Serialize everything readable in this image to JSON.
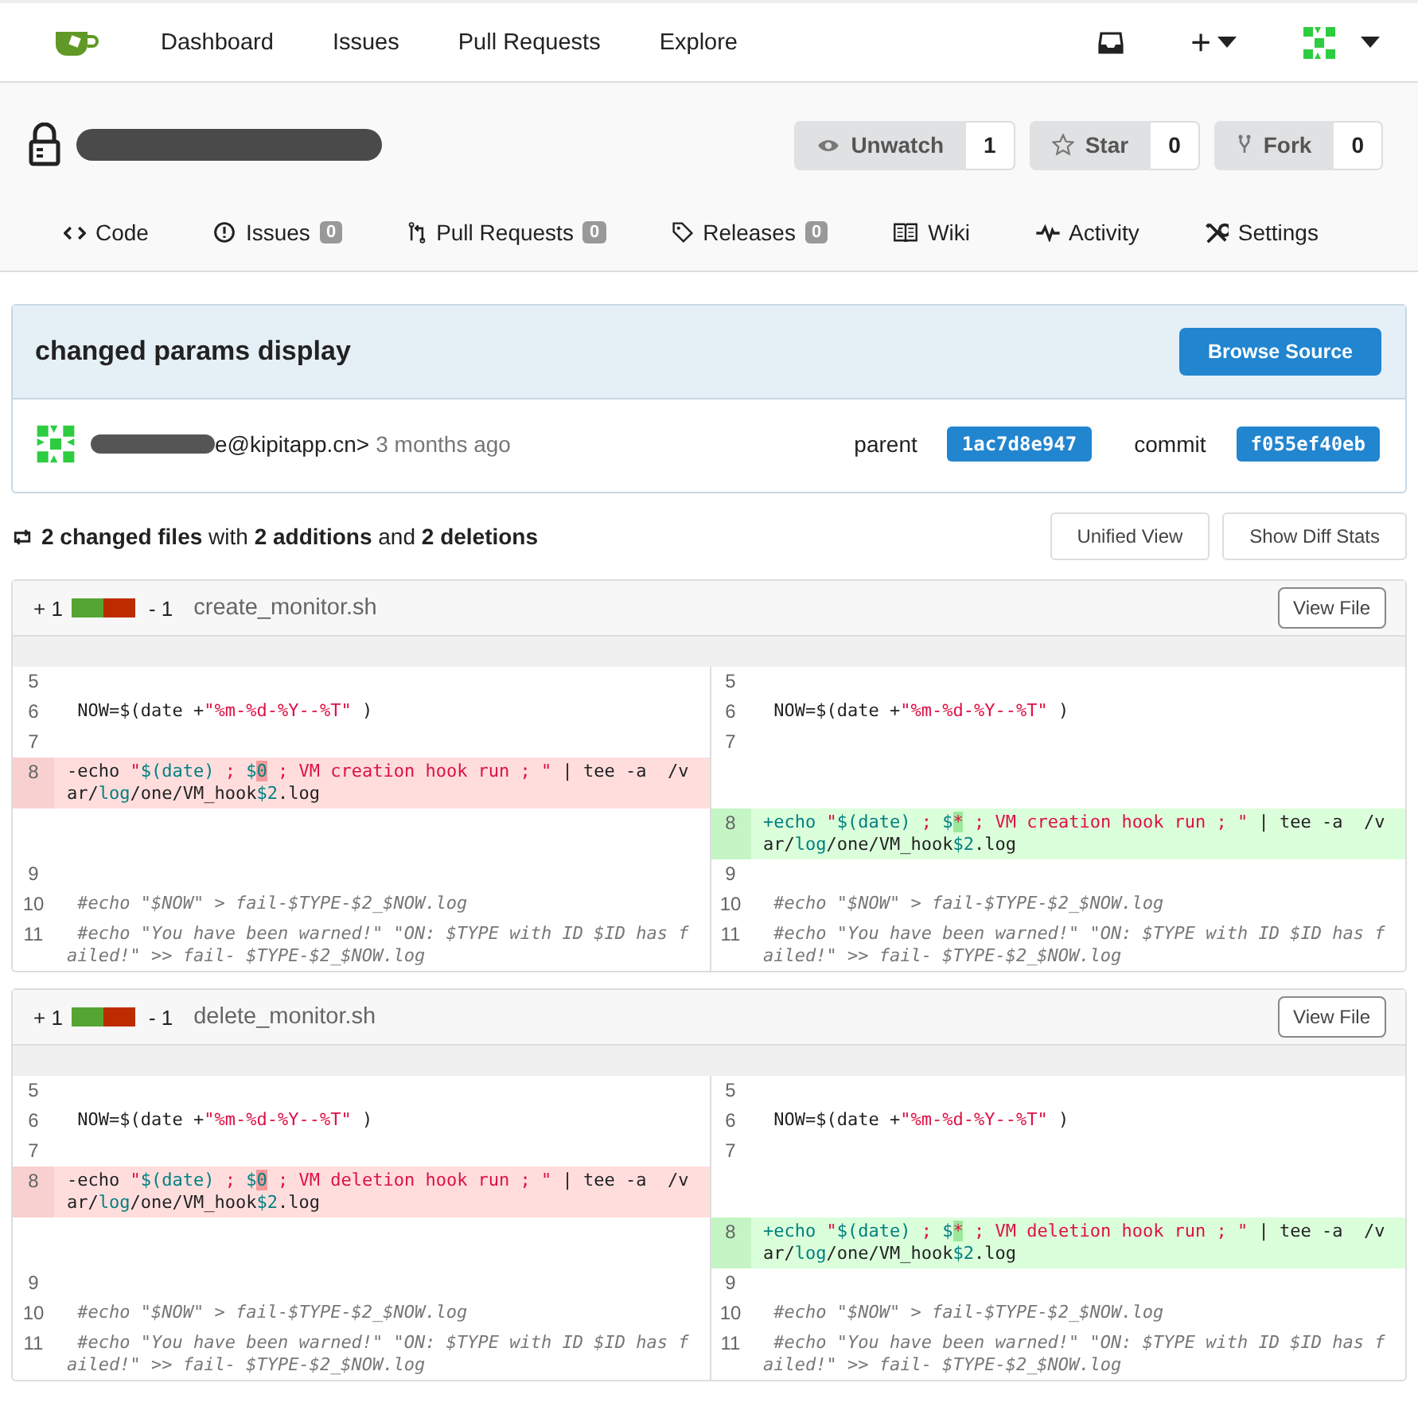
{
  "navbar": {
    "links": [
      "Dashboard",
      "Issues",
      "Pull Requests",
      "Explore"
    ],
    "plus": "+"
  },
  "repo": {
    "actions": [
      {
        "kind": "watch",
        "label": "Unwatch",
        "count": "1"
      },
      {
        "kind": "star",
        "label": "Star",
        "count": "0"
      },
      {
        "kind": "fork",
        "label": "Fork",
        "count": "0"
      }
    ],
    "tabs": [
      {
        "kind": "code",
        "label": "Code"
      },
      {
        "kind": "issues",
        "label": "Issues",
        "count": "0"
      },
      {
        "kind": "pr",
        "label": "Pull Requests",
        "count": "0"
      },
      {
        "kind": "tag",
        "label": "Releases",
        "count": "0"
      },
      {
        "kind": "book",
        "label": "Wiki"
      },
      {
        "kind": "pulse",
        "label": "Activity"
      },
      {
        "kind": "tools",
        "label": "Settings"
      }
    ]
  },
  "commit": {
    "title": "changed params display",
    "browse_button": "Browse Source",
    "author_tail": "e@kipitapp.cn>",
    "time": "3 months ago",
    "parent_label": "parent",
    "parent_sha": "1ac7d8e947",
    "commit_label": "commit",
    "commit_sha": "f055ef40eb"
  },
  "summary": {
    "text": "**2 changed files** with **2 additions** and **2 deletions**",
    "buttons": [
      "Unified View",
      "Show Diff Stats"
    ]
  },
  "files": [
    {
      "additions": "+ 1",
      "deletions": "- 1",
      "level": 0.5,
      "name": "create_monitor.sh",
      "view_button": "View File",
      "rows": [
        {
          "left": {
            "kind": "context",
            "num": "5"
          },
          "right": {
            "kind": "context",
            "num": "5"
          }
        },
        {
          "left": {
            "kind": "context",
            "num": "6",
            "tokens": [
              {
                "kind": "t",
                "s": " NOW=$(date +"
              },
              {
                "kind": "s",
                "s": "\"%m-%d-%Y--%T\""
              },
              {
                "kind": "t",
                "s": " )"
              }
            ]
          },
          "right": {
            "kind": "context",
            "num": "6",
            "tokens": [
              {
                "kind": "t",
                "s": " NOW=$(date +"
              },
              {
                "kind": "s",
                "s": "\"%m-%d-%Y--%T\""
              },
              {
                "kind": "t",
                "s": " )"
              }
            ]
          }
        },
        {
          "left": {
            "kind": "context",
            "num": "7"
          },
          "right": {
            "kind": "context",
            "num": "7"
          }
        },
        {
          "left": {
            "kind": "del",
            "num": "8",
            "tokens": [
              {
                "kind": "t",
                "s": "-echo "
              },
              {
                "kind": "s",
                "s": "\""
              },
              {
                "kind": "v",
                "s": "$(date)"
              },
              {
                "kind": "s",
                "s": " ; "
              },
              {
                "kind": "v",
                "s": "$"
              },
              {
                "kind": "hd",
                "s": "0"
              },
              {
                "kind": "s",
                "s": " ; VM creation hook run ; \""
              },
              {
                "kind": "t",
                "s": " | tee -a  /var/"
              },
              {
                "kind": "v",
                "s": "log"
              },
              {
                "kind": "t",
                "s": "/one/VM_hook"
              },
              {
                "kind": "v",
                "s": "$2"
              },
              {
                "kind": "t",
                "s": ".log"
              }
            ]
          },
          "right": {
            "kind": "empty"
          }
        },
        {
          "left": {
            "kind": "empty"
          },
          "right": {
            "kind": "add",
            "num": "8",
            "tokens": [
              {
                "kind": "v",
                "s": "+echo "
              },
              {
                "kind": "s",
                "s": "\""
              },
              {
                "kind": "v",
                "s": "$(date)"
              },
              {
                "kind": "s",
                "s": " ; "
              },
              {
                "kind": "v",
                "s": "$"
              },
              {
                "kind": "ha",
                "s": "*"
              },
              {
                "kind": "s",
                "s": " ; VM creation hook run ; \""
              },
              {
                "kind": "t",
                "s": " | tee -a  /var/"
              },
              {
                "kind": "v",
                "s": "log"
              },
              {
                "kind": "t",
                "s": "/one/VM_hook"
              },
              {
                "kind": "v",
                "s": "$2"
              },
              {
                "kind": "t",
                "s": ".log"
              }
            ]
          }
        },
        {
          "left": {
            "kind": "context",
            "num": "9"
          },
          "right": {
            "kind": "context",
            "num": "9"
          }
        },
        {
          "left": {
            "kind": "context",
            "num": "10",
            "tokens": [
              {
                "kind": "c",
                "s": " #echo \"$NOW\" > fail-$TYPE-$2_$NOW.log"
              }
            ]
          },
          "right": {
            "kind": "context",
            "num": "10",
            "tokens": [
              {
                "kind": "c",
                "s": " #echo \"$NOW\" > fail-$TYPE-$2_$NOW.log"
              }
            ]
          }
        },
        {
          "left": {
            "kind": "context",
            "num": "11",
            "tokens": [
              {
                "kind": "c",
                "s": " #echo \"You have been warned!\" \"ON: $TYPE with ID $ID has failed!\" >> fail- $TYPE-$2_$NOW.log"
              }
            ]
          },
          "right": {
            "kind": "context",
            "num": "11",
            "tokens": [
              {
                "kind": "c",
                "s": " #echo \"You have been warned!\" \"ON: $TYPE with ID $ID has failed!\" >> fail- $TYPE-$2_$NOW.log"
              }
            ]
          }
        }
      ]
    },
    {
      "additions": "+ 1",
      "deletions": "- 1",
      "level": 0.5,
      "name": "delete_monitor.sh",
      "view_button": "View File",
      "rows": [
        {
          "left": {
            "kind": "context",
            "num": "5"
          },
          "right": {
            "kind": "context",
            "num": "5"
          }
        },
        {
          "left": {
            "kind": "context",
            "num": "6",
            "tokens": [
              {
                "kind": "t",
                "s": " NOW=$(date +"
              },
              {
                "kind": "s",
                "s": "\"%m-%d-%Y--%T\""
              },
              {
                "kind": "t",
                "s": " )"
              }
            ]
          },
          "right": {
            "kind": "context",
            "num": "6",
            "tokens": [
              {
                "kind": "t",
                "s": " NOW=$(date +"
              },
              {
                "kind": "s",
                "s": "\"%m-%d-%Y--%T\""
              },
              {
                "kind": "t",
                "s": " )"
              }
            ]
          }
        },
        {
          "left": {
            "kind": "context",
            "num": "7"
          },
          "right": {
            "kind": "context",
            "num": "7"
          }
        },
        {
          "left": {
            "kind": "del",
            "num": "8",
            "tokens": [
              {
                "kind": "t",
                "s": "-echo "
              },
              {
                "kind": "s",
                "s": "\""
              },
              {
                "kind": "v",
                "s": "$(date)"
              },
              {
                "kind": "s",
                "s": " ; "
              },
              {
                "kind": "v",
                "s": "$"
              },
              {
                "kind": "hd",
                "s": "0"
              },
              {
                "kind": "s",
                "s": " ; VM deletion hook run ; \""
              },
              {
                "kind": "t",
                "s": " | tee -a  /var/"
              },
              {
                "kind": "v",
                "s": "log"
              },
              {
                "kind": "t",
                "s": "/one/VM_hook"
              },
              {
                "kind": "v",
                "s": "$2"
              },
              {
                "kind": "t",
                "s": ".log"
              }
            ]
          },
          "right": {
            "kind": "empty"
          }
        },
        {
          "left": {
            "kind": "empty"
          },
          "right": {
            "kind": "add",
            "num": "8",
            "tokens": [
              {
                "kind": "v",
                "s": "+echo "
              },
              {
                "kind": "s",
                "s": "\""
              },
              {
                "kind": "v",
                "s": "$(date)"
              },
              {
                "kind": "s",
                "s": " ; "
              },
              {
                "kind": "v",
                "s": "$"
              },
              {
                "kind": "ha",
                "s": "*"
              },
              {
                "kind": "s",
                "s": " ; VM deletion hook run ; \""
              },
              {
                "kind": "t",
                "s": " | tee -a  /var/"
              },
              {
                "kind": "v",
                "s": "log"
              },
              {
                "kind": "t",
                "s": "/one/VM_hook"
              },
              {
                "kind": "v",
                "s": "$2"
              },
              {
                "kind": "t",
                "s": ".log"
              }
            ]
          }
        },
        {
          "left": {
            "kind": "context",
            "num": "9"
          },
          "right": {
            "kind": "context",
            "num": "9"
          }
        },
        {
          "left": {
            "kind": "context",
            "num": "10",
            "tokens": [
              {
                "kind": "c",
                "s": " #echo \"$NOW\" > fail-$TYPE-$2_$NOW.log"
              }
            ]
          },
          "right": {
            "kind": "context",
            "num": "10",
            "tokens": [
              {
                "kind": "c",
                "s": " #echo \"$NOW\" > fail-$TYPE-$2_$NOW.log"
              }
            ]
          }
        },
        {
          "left": {
            "kind": "context",
            "num": "11",
            "tokens": [
              {
                "kind": "c",
                "s": " #echo \"You have been warned!\" \"ON: $TYPE with ID $ID has failed!\" >> fail- $TYPE-$2_$NOW.log"
              }
            ]
          },
          "right": {
            "kind": "context",
            "num": "11",
            "tokens": [
              {
                "kind": "c",
                "s": " #echo \"You have been warned!\" \"ON: $TYPE with ID $ID has failed!\" >> fail- $TYPE-$2_$NOW.log"
              }
            ]
          }
        }
      ]
    }
  ]
}
